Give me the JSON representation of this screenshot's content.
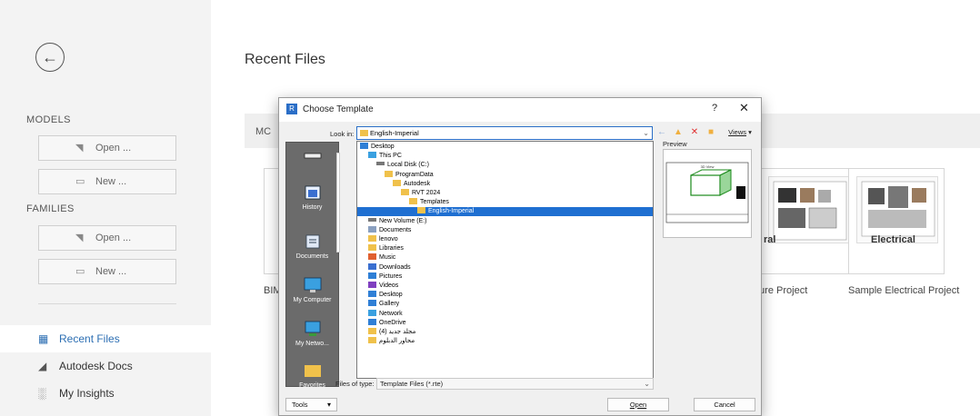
{
  "sidebar": {
    "models_label": "MODELS",
    "families_label": "FAMILIES",
    "models_open": "Open ...",
    "models_new": "New ...",
    "families_open": "Open ...",
    "families_new": "New ...",
    "nav": {
      "recent": "Recent Files",
      "docs": "Autodesk Docs",
      "insights": "My Insights"
    }
  },
  "main": {
    "title": "Recent Files",
    "models_band_label": "MC",
    "left_card_label": "BIM",
    "cards": [
      {
        "caption": "ral",
        "label": "ture Project"
      },
      {
        "caption": "Electrical",
        "label": "Sample Electrical Project"
      }
    ]
  },
  "dialog": {
    "title": "Choose Template",
    "help": "?",
    "close": "✕",
    "look_in_label": "Look in:",
    "look_in_value": "English-Imperial",
    "views_label": "Views",
    "preview_label": "Preview",
    "places": [
      "History",
      "Documents",
      "My Computer",
      "My Netwo...",
      "Favorites"
    ],
    "tree": [
      {
        "text": "Desktop",
        "indent": 0,
        "icon": "desktop"
      },
      {
        "text": "This PC",
        "indent": 1,
        "icon": "pc"
      },
      {
        "text": "Local Disk (C:)",
        "indent": 2,
        "icon": "drive"
      },
      {
        "text": "ProgramData",
        "indent": 3,
        "icon": "folder"
      },
      {
        "text": "Autodesk",
        "indent": 4,
        "icon": "folder"
      },
      {
        "text": "RVT 2024",
        "indent": 5,
        "icon": "folder"
      },
      {
        "text": "Templates",
        "indent": 6,
        "icon": "folder"
      },
      {
        "text": "English-Imperial",
        "indent": 7,
        "icon": "folder",
        "selected": true
      },
      {
        "text": "New Volume (E:)",
        "indent": 1,
        "icon": "drive"
      },
      {
        "text": "Documents",
        "indent": 1,
        "icon": "doc"
      },
      {
        "text": "lenovo",
        "indent": 1,
        "icon": "folder"
      },
      {
        "text": "Libraries",
        "indent": 1,
        "icon": "folder"
      },
      {
        "text": "Music",
        "indent": 1,
        "icon": "music"
      },
      {
        "text": "Downloads",
        "indent": 1,
        "icon": "download"
      },
      {
        "text": "Pictures",
        "indent": 1,
        "icon": "pictures"
      },
      {
        "text": "Videos",
        "indent": 1,
        "icon": "videos"
      },
      {
        "text": "Desktop",
        "indent": 1,
        "icon": "desktop"
      },
      {
        "text": "Gallery",
        "indent": 1,
        "icon": "pictures"
      },
      {
        "text": "Network",
        "indent": 1,
        "icon": "network"
      },
      {
        "text": "OneDrive",
        "indent": 1,
        "icon": "cloud"
      },
      {
        "text": "(4) مجلد جديد",
        "indent": 1,
        "icon": "folder"
      },
      {
        "text": "محاور الدبلوم",
        "indent": 1,
        "icon": "folder"
      }
    ],
    "files_of_type_label": "Files of type:",
    "files_of_type_value": "Template Files  (*.rte)",
    "tools_label": "Tools",
    "open_label": "Open",
    "cancel_label": "Cancel"
  },
  "colors": {
    "accent": "#2d6fb3",
    "selection": "#1f6fd1",
    "folder": "#f0c14b"
  }
}
